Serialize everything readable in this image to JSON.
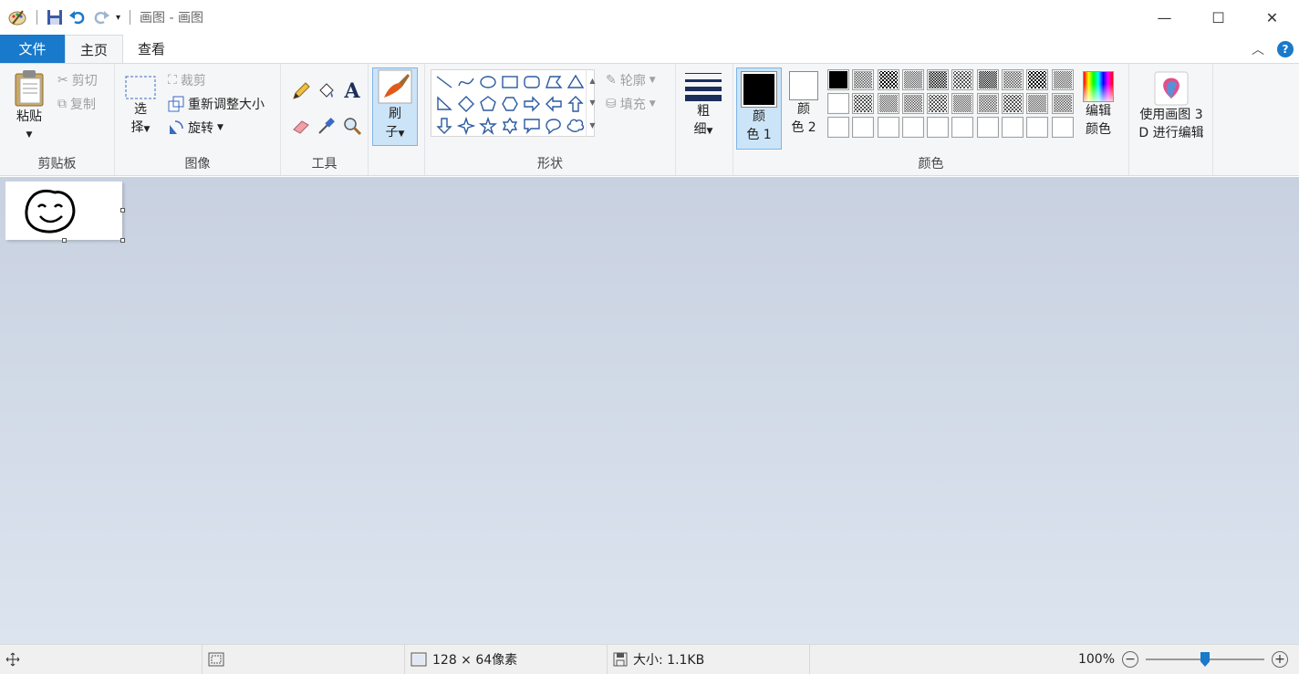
{
  "window": {
    "title": "画图 - 画图",
    "controls": {
      "minimize": "—",
      "maximize": "☐",
      "close": "✕"
    }
  },
  "tabs": {
    "file": "文件",
    "home": "主页",
    "view": "查看"
  },
  "ribbon": {
    "clipboard": {
      "label": "剪贴板",
      "paste": "粘贴",
      "cut": "剪切",
      "copy": "复制"
    },
    "image": {
      "label": "图像",
      "select_line1": "选",
      "select_line2": "择",
      "crop": "裁剪",
      "resize": "重新调整大小",
      "rotate": "旋转"
    },
    "tools": {
      "label": "工具"
    },
    "brush": {
      "line1": "刷",
      "line2": "子"
    },
    "shapes": {
      "label": "形状",
      "outline": "轮廓",
      "fill": "填充"
    },
    "size": {
      "line1": "粗",
      "line2": "细"
    },
    "colors": {
      "label": "颜色",
      "color1_line1": "颜",
      "color1_line2": "色 1",
      "color2_line1": "颜",
      "color2_line2": "色 2",
      "edit_line1": "编辑",
      "edit_line2": "颜色",
      "color1_value": "#000000",
      "color2_value": "#ffffff"
    },
    "paint3d": {
      "line1": "使用画图 3",
      "line2": "D 进行编辑"
    }
  },
  "status": {
    "dimensions": "128 × 64像素",
    "size": "大小: 1.1KB",
    "zoom": "100%"
  },
  "zoom_slider": {
    "level_fraction": 0.5
  },
  "accent_color": "#1979ca"
}
